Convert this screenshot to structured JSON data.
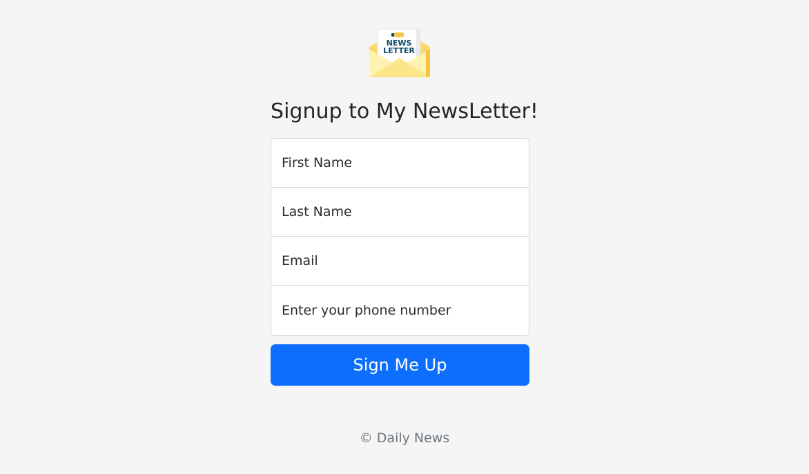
{
  "logo": {
    "icon": "newsletter-envelope-icon",
    "line1": "NEWS",
    "line2": "LETTER"
  },
  "heading": "Signup to My NewsLetter!",
  "form": {
    "first_name_placeholder": "First Name",
    "last_name_placeholder": "Last Name",
    "email_placeholder": "Email",
    "phone_placeholder": "Enter your phone number",
    "submit_label": "Sign Me Up"
  },
  "footer": {
    "text": "© Daily News"
  },
  "colors": {
    "background": "#f5f5f5",
    "primary": "#0d6efd",
    "envelope": "#fde68a",
    "logo_text": "#0b4a6b"
  }
}
